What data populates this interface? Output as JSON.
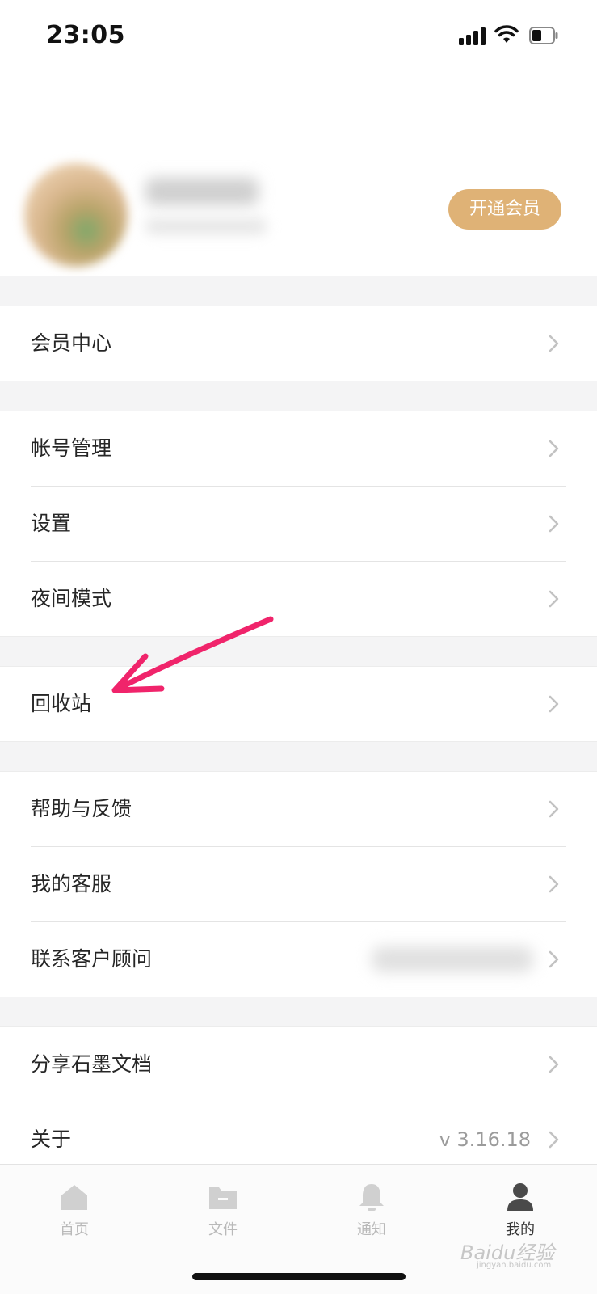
{
  "status_bar": {
    "time": "23:05"
  },
  "profile": {
    "vip_button_label": "开通会员"
  },
  "menu": {
    "member_center": "会员中心",
    "account_management": "帐号管理",
    "settings": "设置",
    "night_mode": "夜间模式",
    "recycle_bin": "回收站",
    "help_feedback": "帮助与反馈",
    "my_customer_service": "我的客服",
    "contact_advisor": "联系客户顾问",
    "share": "分享石墨文档",
    "about": "关于",
    "version": "v 3.16.18"
  },
  "tabbar": {
    "home": "首页",
    "files": "文件",
    "notifications": "通知",
    "me": "我的"
  },
  "watermark": {
    "text": "Baidu经验",
    "sub": "jingyan.baidu.com"
  },
  "colors": {
    "vip_button": "#dfb276",
    "annotation_arrow": "#f0246b",
    "active_tab": "#333333",
    "inactive_tab": "#c9c9c9"
  },
  "icons": [
    "signal-icon",
    "wifi-icon",
    "battery-icon",
    "chevron-right-icon",
    "home-icon",
    "folder-icon",
    "bell-icon",
    "person-icon"
  ]
}
